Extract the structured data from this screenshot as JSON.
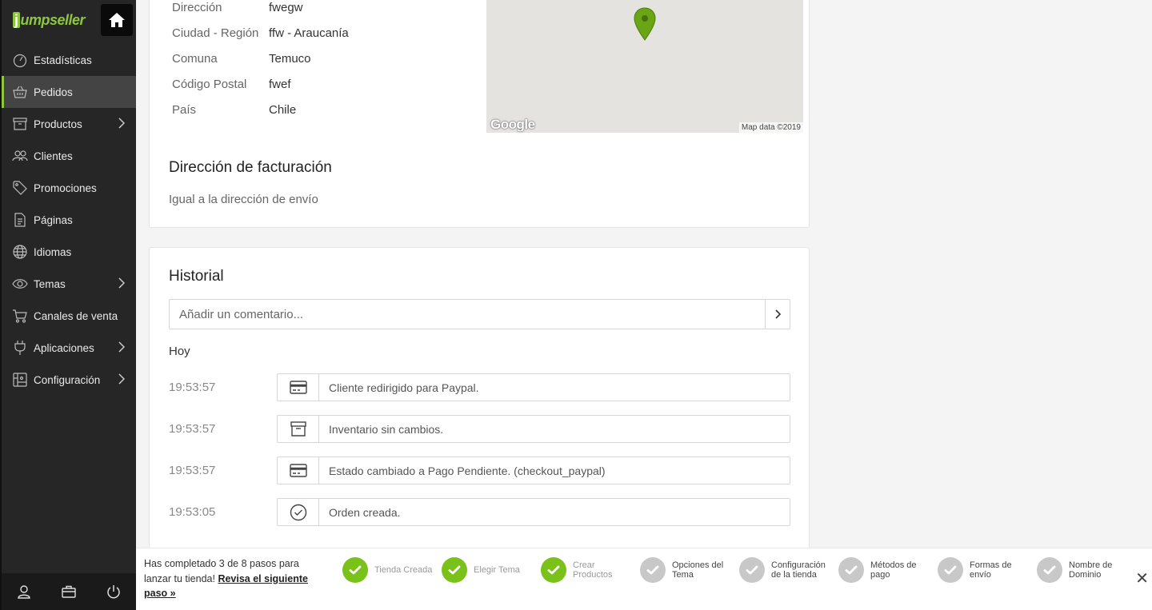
{
  "brand": {
    "logo_text": "jumpseller",
    "accent": "#8dc63f"
  },
  "sidebar": {
    "items": [
      {
        "label": "Estadísticas",
        "icon": "speedometer-icon",
        "chevron": false,
        "active": false
      },
      {
        "label": "Pedidos",
        "icon": "basket-icon",
        "chevron": false,
        "active": true
      },
      {
        "label": "Productos",
        "icon": "box-icon",
        "chevron": true,
        "active": false
      },
      {
        "label": "Clientes",
        "icon": "users-icon",
        "chevron": false,
        "active": false
      },
      {
        "label": "Promociones",
        "icon": "tags-icon",
        "chevron": false,
        "active": false
      },
      {
        "label": "Páginas",
        "icon": "page-icon",
        "chevron": false,
        "active": false
      },
      {
        "label": "Idiomas",
        "icon": "globe-icon",
        "chevron": false,
        "active": false
      },
      {
        "label": "Temas",
        "icon": "eye-icon",
        "chevron": true,
        "active": false
      },
      {
        "label": "Canales de venta",
        "icon": "cart-icon",
        "chevron": false,
        "active": false
      },
      {
        "label": "Aplicaciones",
        "icon": "plug-icon",
        "chevron": true,
        "active": false
      },
      {
        "label": "Configuración",
        "icon": "settings-icon",
        "chevron": true,
        "active": false
      }
    ]
  },
  "address": {
    "rows": [
      {
        "label": "Dirección",
        "value": "fwegw"
      },
      {
        "label": "Ciudad - Región",
        "value": "ffw - Araucanía"
      },
      {
        "label": "Comuna",
        "value": "Temuco"
      },
      {
        "label": "Código Postal",
        "value": "fwef"
      },
      {
        "label": "País",
        "value": "Chile"
      }
    ]
  },
  "map": {
    "logo": "Google",
    "attribution": "Map data ©2019"
  },
  "billing": {
    "title": "Dirección de facturación",
    "text": "Igual a la dirección de envío"
  },
  "history": {
    "title": "Historial",
    "comment_placeholder": "Añadir un comentario...",
    "day": "Hoy",
    "events": [
      {
        "time": "19:53:57",
        "icon": "credit-card-icon",
        "text": "Cliente redirigido para Paypal."
      },
      {
        "time": "19:53:57",
        "icon": "archive-icon",
        "text": "Inventario sin cambios."
      },
      {
        "time": "19:53:57",
        "icon": "credit-card-icon",
        "text": "Estado cambiado a Pago Pendiente. (checkout_paypal)"
      },
      {
        "time": "19:53:05",
        "icon": "check-circle-icon",
        "text": "Orden creada."
      }
    ]
  },
  "onboarding": {
    "text": "Has completado 3 de 8 pasos para lanzar tu tienda!",
    "link": "Revisa el siguiente paso »",
    "completed": 3,
    "total": 8,
    "steps": [
      {
        "label": "Tienda Creada",
        "done": true
      },
      {
        "label": "Elegir Tema",
        "done": true
      },
      {
        "label": "Crear Productos",
        "done": true
      },
      {
        "label": "Opciones del Tema",
        "done": false
      },
      {
        "label": "Configuración de la tienda",
        "done": false
      },
      {
        "label": "Métodos de pago",
        "done": false
      },
      {
        "label": "Formas de envío",
        "done": false
      },
      {
        "label": "Nombre de Dominio",
        "done": false
      }
    ],
    "close": "✕"
  }
}
